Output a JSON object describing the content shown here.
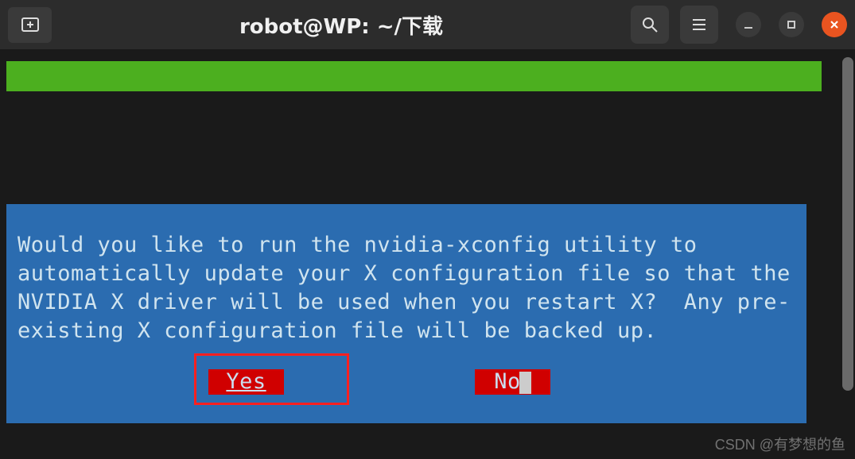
{
  "titlebar": {
    "title": "robot@WP: ~/下载",
    "new_tab_tooltip": "New Tab",
    "search_tooltip": "Search",
    "menu_tooltip": "Menu",
    "minimize_tooltip": "Minimize",
    "maximize_tooltip": "Maximize",
    "close_tooltip": "Close"
  },
  "dialog": {
    "message": "Would you like to run the nvidia-xconfig utility to automatically update your X configuration file so that the NVIDIA X driver will be used when you restart X?  Any pre-existing X configuration file will be backed up.",
    "yes_label": "Yes",
    "no_label": "No"
  },
  "watermark": "CSDN @有梦想的鱼"
}
